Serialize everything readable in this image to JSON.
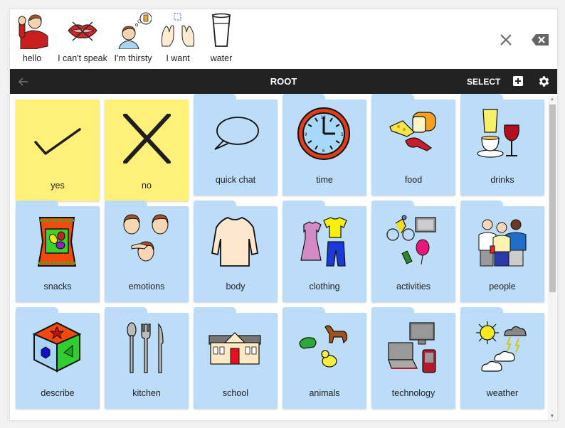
{
  "sentence": {
    "words": [
      {
        "label": "hello",
        "icon": "waving-person-icon"
      },
      {
        "label": "I can't speak",
        "icon": "crossed-lips-icon"
      },
      {
        "label": "I'm thirsty",
        "icon": "thirsty-person-icon"
      },
      {
        "label": "I want",
        "icon": "reaching-hands-icon"
      },
      {
        "label": "water",
        "icon": "glass-icon"
      }
    ],
    "clear_icon": "close-icon",
    "backspace_icon": "backspace-icon"
  },
  "toolbar": {
    "back_icon": "arrow-left-icon",
    "title": "ROOT",
    "select_label": "SELECT",
    "add_icon": "plus-square-icon",
    "settings_icon": "gear-icon"
  },
  "grid": {
    "colors": {
      "yellow": "#fff07a",
      "folder": "#bcdcf7"
    },
    "tiles": [
      {
        "label": "yes",
        "type": "button",
        "color": "yellow",
        "icon": "checkmark-icon"
      },
      {
        "label": "no",
        "type": "button",
        "color": "yellow",
        "icon": "x-mark-icon"
      },
      {
        "label": "quick chat",
        "type": "folder",
        "color": "folder",
        "icon": "speech-bubble-icon"
      },
      {
        "label": "time",
        "type": "folder",
        "color": "folder",
        "icon": "clock-icon"
      },
      {
        "label": "food",
        "type": "folder",
        "color": "folder",
        "icon": "food-icon"
      },
      {
        "label": "drinks",
        "type": "folder",
        "color": "folder",
        "icon": "drinks-icon"
      },
      {
        "label": "snacks",
        "type": "folder",
        "color": "folder",
        "icon": "snack-bag-icon"
      },
      {
        "label": "emotions",
        "type": "folder",
        "color": "folder",
        "icon": "faces-icon"
      },
      {
        "label": "body",
        "type": "folder",
        "color": "folder",
        "icon": "torso-icon"
      },
      {
        "label": "clothing",
        "type": "folder",
        "color": "folder",
        "icon": "clothes-icon"
      },
      {
        "label": "activities",
        "type": "folder",
        "color": "folder",
        "icon": "activities-icon"
      },
      {
        "label": "people",
        "type": "folder",
        "color": "folder",
        "icon": "people-icon"
      },
      {
        "label": "describe",
        "type": "folder",
        "color": "folder",
        "icon": "shape-cube-icon"
      },
      {
        "label": "kitchen",
        "type": "folder",
        "color": "folder",
        "icon": "cutlery-icon"
      },
      {
        "label": "school",
        "type": "folder",
        "color": "folder",
        "icon": "school-building-icon"
      },
      {
        "label": "animals",
        "type": "folder",
        "color": "folder",
        "icon": "animals-icon"
      },
      {
        "label": "technology",
        "type": "folder",
        "color": "folder",
        "icon": "devices-icon"
      },
      {
        "label": "weather",
        "type": "folder",
        "color": "folder",
        "icon": "weather-icon"
      }
    ]
  }
}
